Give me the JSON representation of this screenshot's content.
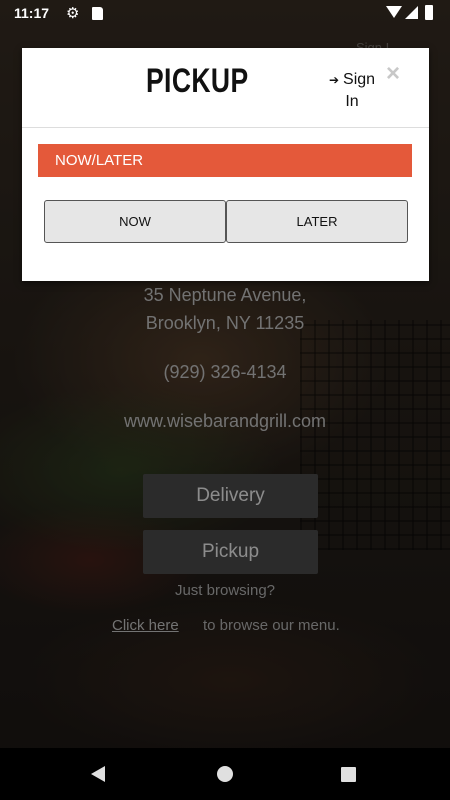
{
  "status_bar": {
    "time": "11:17"
  },
  "background": {
    "signin_hint": "Sign I",
    "address_line1": "35 Neptune Avenue,",
    "address_line2": "Brooklyn, NY 11235",
    "phone": "(929) 326-4134",
    "website": "www.wisebarandgrill.com",
    "delivery_label": "Delivery",
    "pickup_label": "Pickup",
    "browsing_text": "Just browsing?",
    "click_here": "Click here",
    "browse_menu_text": "to browse our menu."
  },
  "modal": {
    "title": "PICKUP",
    "sign_in": "Sign In",
    "close_symbol": "×",
    "section_label": "NOW/LATER",
    "options": [
      "NOW",
      "LATER"
    ],
    "accent_color": "#e4593a"
  },
  "icons": [
    "gear-icon",
    "sd-card-icon",
    "wifi-icon",
    "signal-icon",
    "battery-icon",
    "sign-in-icon",
    "close-icon",
    "back-icon",
    "home-icon",
    "recents-icon"
  ]
}
